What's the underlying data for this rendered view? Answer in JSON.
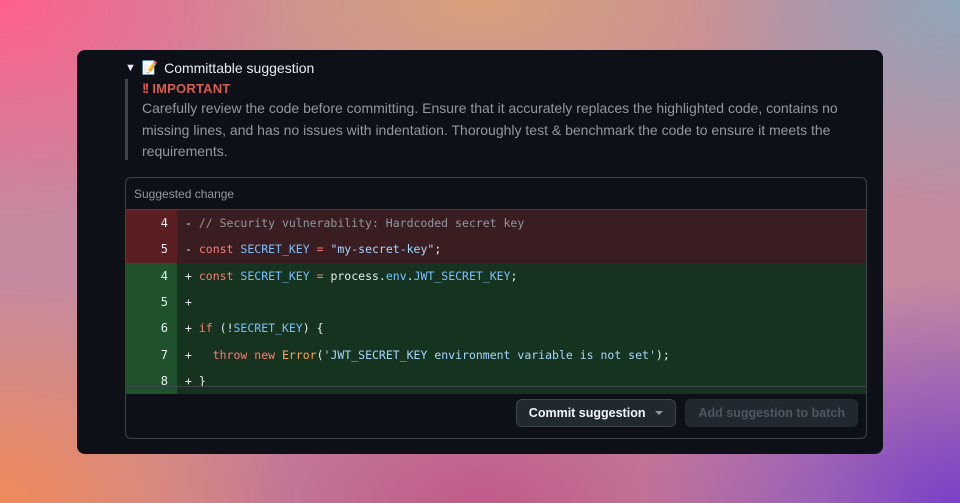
{
  "details": {
    "toggle_glyph": "▼",
    "emoji": "📝",
    "title": "Committable suggestion"
  },
  "alert": {
    "marker": "!!",
    "title": "IMPORTANT",
    "body": "Carefully review the code before committing. Ensure that it accurately replaces the highlighted code, contains no missing lines, and has no issues with indentation. Thoroughly test & benchmark the code to ensure it meets the requirements."
  },
  "suggestion": {
    "header": "Suggested change",
    "lines": [
      {
        "type": "del",
        "num": "4"
      },
      {
        "type": "del",
        "num": "5"
      },
      {
        "type": "add",
        "num": "4"
      },
      {
        "type": "add",
        "num": "5"
      },
      {
        "type": "add",
        "num": "6"
      },
      {
        "type": "add",
        "num": "7"
      },
      {
        "type": "add",
        "num": "8"
      }
    ],
    "code": {
      "l1_comment": "// Security vulnerability: Hardcoded secret key",
      "kw_const": "const",
      "secret_key": "SECRET_KEY",
      "eq": " = ",
      "secret_value": "\"my-secret-key\"",
      "semicolon": ";",
      "process": "process",
      "dot": ".",
      "env": "env",
      "jwt_key": "JWT_SECRET_KEY",
      "kw_if": "if",
      "if_open": " (!",
      "if_close": ") {",
      "kw_throw": "throw",
      "kw_new": "new",
      "error_fn": "Error",
      "error_msg": "'JWT_SECRET_KEY environment variable is not set'",
      "paren_open": "(",
      "paren_close": ");",
      "close_brace": "}"
    }
  },
  "actions": {
    "commit_label": "Commit suggestion",
    "batch_label": "Add suggestion to batch"
  }
}
